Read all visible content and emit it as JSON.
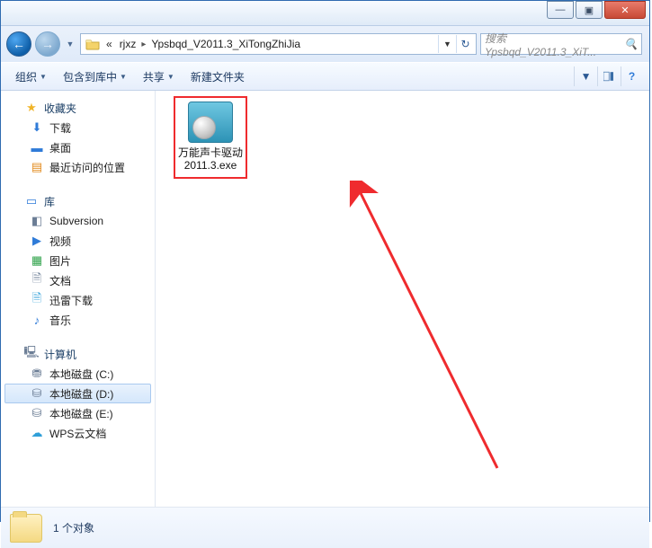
{
  "titlebar": {
    "min": "—",
    "max": "▣",
    "close": "✕"
  },
  "nav": {
    "back_glyph": "←",
    "fwd_glyph": "→",
    "dropdown_glyph": "▼",
    "crumb_prefix": "«",
    "crumb_sep": "▸",
    "crumbs": [
      "rjxz",
      "Ypsbqd_V2011.3_XiTongZhiJia"
    ],
    "refresh_glyph": "↻"
  },
  "search": {
    "placeholder": "搜索 Ypsbqd_V2011.3_XiT...",
    "icon": "🔍"
  },
  "toolbar": {
    "organize": "组织",
    "include": "包含到库中",
    "share": "共享",
    "newfolder": "新建文件夹",
    "chev": "▼"
  },
  "sidebar": {
    "favorites": {
      "label": "收藏夹",
      "items": [
        {
          "icon": "⬇",
          "cls": "c-blue",
          "label": "下载"
        },
        {
          "icon": "▬",
          "cls": "c-blue",
          "label": "桌面"
        },
        {
          "icon": "▤",
          "cls": "c-orange",
          "label": "最近访问的位置"
        }
      ]
    },
    "libraries": {
      "label": "库",
      "items": [
        {
          "icon": "◧",
          "cls": "c-gray",
          "label": "Subversion"
        },
        {
          "icon": "▶",
          "cls": "c-blue",
          "label": "视频"
        },
        {
          "icon": "▦",
          "cls": "c-green",
          "label": "图片"
        },
        {
          "icon": "🗎",
          "cls": "c-gray",
          "label": "文档"
        },
        {
          "icon": "🗎",
          "cls": "c-cyan",
          "label": "迅雷下载"
        },
        {
          "icon": "♪",
          "cls": "c-blue",
          "label": "音乐"
        }
      ]
    },
    "computer": {
      "label": "计算机",
      "items": [
        {
          "icon": "⛃",
          "cls": "c-gray",
          "label": "本地磁盘 (C:)",
          "sel": false
        },
        {
          "icon": "⛁",
          "cls": "c-gray",
          "label": "本地磁盘 (D:)",
          "sel": true
        },
        {
          "icon": "⛁",
          "cls": "c-gray",
          "label": "本地磁盘 (E:)",
          "sel": false
        },
        {
          "icon": "☁",
          "cls": "c-cyan",
          "label": "WPS云文档",
          "sel": false
        }
      ]
    }
  },
  "content": {
    "file_label": "万能声卡驱动2011.3.exe"
  },
  "status": {
    "text": "1 个对象"
  },
  "annotation": {
    "highlight_color": "#ef2b2e"
  }
}
